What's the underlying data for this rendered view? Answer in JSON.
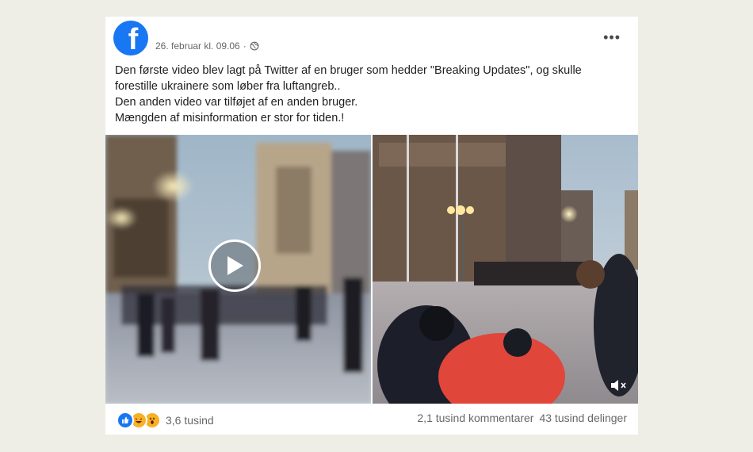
{
  "post": {
    "timestamp": "26. februar kl. 09.06",
    "separator": "·",
    "text_lines": [
      "Den første video blev lagt på Twitter af en bruger som hedder \"Breaking Updates\", og skulle",
      "forestille ukrainere som løber fra luftangreb..",
      "Den anden video var tilføjet af en anden bruger.",
      "Mængden af misinformation er stor for tiden.!"
    ]
  },
  "icons": {
    "avatar": "facebook-logo",
    "privacy": "globe-icon",
    "menu": "more-options-icon",
    "play": "play-icon",
    "mute": "volume-mute-icon",
    "reactions": [
      "like-icon",
      "haha-icon",
      "wow-icon"
    ]
  },
  "reactions": {
    "count": "3,6 tusind"
  },
  "stats": {
    "comments": "2,1 tusind kommentarer",
    "shares": "43 tusind delinger"
  },
  "colors": {
    "brand": "#1877f2",
    "page_bg": "#efeee6",
    "muted_text": "#65676b"
  }
}
